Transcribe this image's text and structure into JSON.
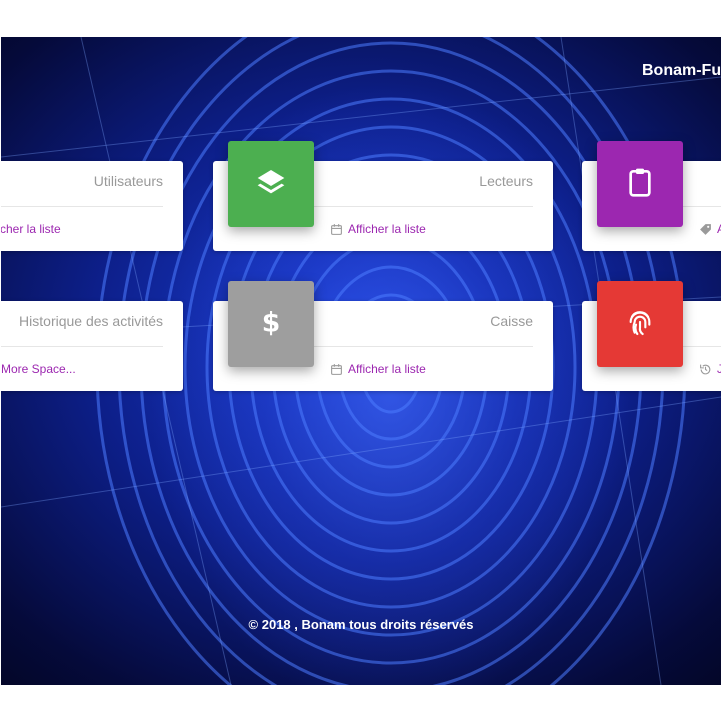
{
  "brand": {
    "title": "Bonam-Fu"
  },
  "cards": [
    {
      "title": "Utilisateurs",
      "link": "cher la liste"
    },
    {
      "title": "Lecteurs",
      "link": "Afficher la liste"
    },
    {
      "title": "",
      "link": "A"
    },
    {
      "title": "Historique des activités",
      "link": "More Space..."
    },
    {
      "title": "Caisse",
      "link": "Afficher la liste"
    },
    {
      "title": "",
      "link": "J"
    }
  ],
  "icons": {
    "layers": "layers-icon",
    "clipboard": "clipboard-icon",
    "dollar": "dollar-icon",
    "fingerprint": "fingerprint-icon",
    "calendar": "calendar-icon",
    "tag": "tag-icon",
    "history": "history-icon"
  },
  "colors": {
    "green": "#4caf50",
    "purple": "#9c27b0",
    "grey": "#9e9e9e",
    "red": "#e53935",
    "link": "#9c27b0"
  },
  "footer": {
    "copyright": "© 2018 , Bonam tous droits réservés"
  }
}
